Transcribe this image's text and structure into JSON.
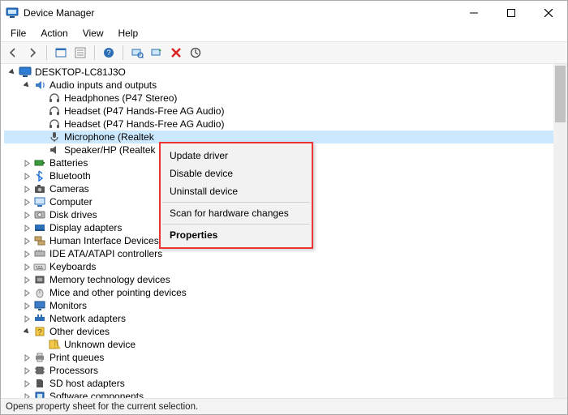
{
  "title": "Device Manager",
  "menus": {
    "file": "File",
    "action": "Action",
    "view": "View",
    "help": "Help"
  },
  "toolbar": {
    "back": "back",
    "forward": "forward",
    "up": "up",
    "show_hidden": "show-hidden",
    "help_btn": "help",
    "scan": "scan",
    "refresh": "refresh",
    "remove": "remove",
    "action_btn": "action"
  },
  "root": {
    "name": "DESKTOP-LC81J3O"
  },
  "audio": {
    "name": "Audio inputs and outputs",
    "children": {
      "headphones": "Headphones (P47 Stereo)",
      "headset1": "Headset (P47 Hands-Free AG Audio)",
      "headset2": "Headset (P47 Hands-Free AG Audio)",
      "microphone": "Microphone (Realtek ",
      "speaker": "Speaker/HP (Realtek "
    }
  },
  "categories": {
    "batteries": "Batteries",
    "bluetooth": "Bluetooth",
    "cameras": "Cameras",
    "computer": "Computer",
    "diskdrives": "Disk drives",
    "displayadapters": "Display adapters",
    "hid": "Human Interface Devices",
    "ide": "IDE ATA/ATAPI controllers",
    "keyboards": "Keyboards",
    "memory": "Memory technology devices",
    "mice": "Mice and other pointing devices",
    "monitors": "Monitors",
    "network": "Network adapters",
    "other": "Other devices",
    "other_unknown": "Unknown device",
    "printqueues": "Print queues",
    "processors": "Processors",
    "sdhost": "SD host adapters",
    "software": "Software components"
  },
  "context_menu": {
    "update": "Update driver",
    "disable": "Disable device",
    "uninstall": "Uninstall device",
    "scan": "Scan for hardware changes",
    "properties": "Properties"
  },
  "status": "Opens property sheet for the current selection."
}
